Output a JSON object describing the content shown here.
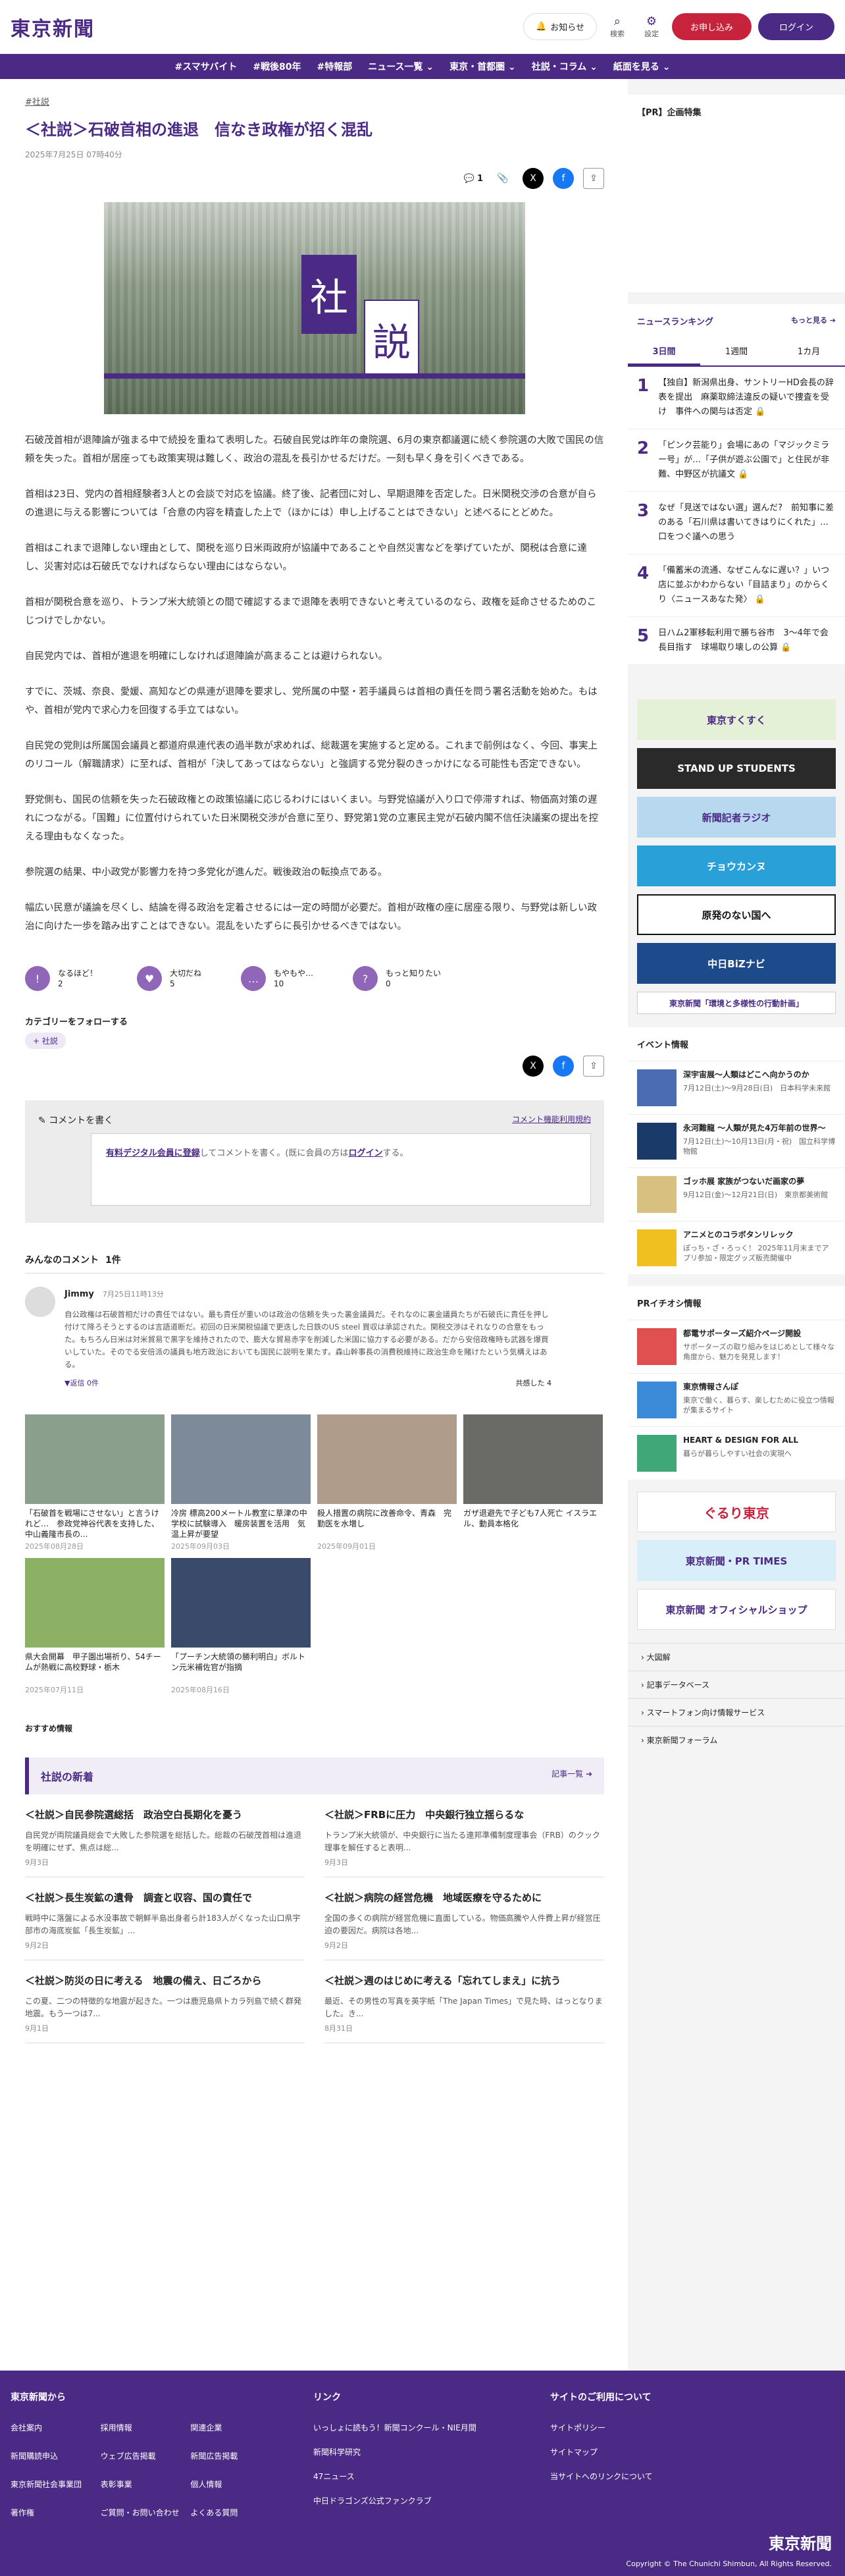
{
  "header": {
    "logo": "東京新聞",
    "notice": "お知らせ",
    "search": "検索",
    "settings": "設定",
    "apply": "お申し込み",
    "login": "ログイン"
  },
  "nav": [
    "#スマサバイト",
    "#戦後80年",
    "#特報部",
    "ニュース一覧 ⌄",
    "東京・首都圏 ⌄",
    "社説・コラム ⌄",
    "紙面を見る ⌄"
  ],
  "article": {
    "tag": "#社説",
    "title": "＜社説＞石破首相の進退　信なき政権が招く混乱",
    "date": "2025年7月25日 07時40分",
    "comment_count": "1",
    "hero_k1": "社",
    "hero_k2": "説",
    "paragraphs": [
      "石破茂首相が退陣論が強まる中で続投を重ねて表明した。石破自民党は昨年の衆院選、6月の東京都議選に続く参院選の大敗で国民の信頼を失った。首相が居座っても政策実現は難しく、政治の混乱を長引かせるだけだ。一刻も早く身を引くべきである。",
      "首相は23日、党内の首相経験者3人との会談で対応を協議。終了後、記者団に対し、早期退陣を否定した。日米関税交渉の合意が自らの進退に与える影響については「合意の内容を精査した上で（ほかには）申し上げることはできない」と述べるにとどめた。",
      "首相はこれまで退陣しない理由として、関税を巡り日米両政府が協議中であることや自然災害などを挙げていたが、関税は合意に達し、災害対応は石破氏でなければならない理由にはならない。",
      "首相が関税合意を巡り、トランプ米大統領との間で確認するまで退陣を表明できないと考えているのなら、政権を延命させるためのこじつけでしかない。",
      "自民党内では、首相が進退を明確にしなければ退陣論が高まることは避けられない。",
      "すでに、茨城、奈良、愛媛、高知などの県連が退陣を要求し、党所属の中堅・若手議員らは首相の責任を問う署名活動を始めた。もはや、首相が党内で求心力を回復する手立てはない。",
      "自民党の党則は所属国会議員と都道府県連代表の過半数が求めれば、総裁選を実施すると定める。これまで前例はなく、今回、事実上のリコール（解職請求）に至れば、首相が「決してあってはならない」と強調する党分裂のきっかけになる可能性も否定できない。",
      "野党側も、国民の信頼を失った石破政権との政策協議に応じるわけにはいくまい。与野党協議が入り口で停滞すれば、物価高対策の遅れにつながる。「国難」に位置付けられていた日米関税交渉が合意に至り、野党第1党の立憲民主党が石破内閣不信任決議案の提出を控える理由もなくなった。",
      "参院選の結果、中小政党が影響力を持つ多党化が進んだ。戦後政治の転換点である。",
      "幅広い民意が議論を尽くし、結論を得る政治を定着させるには一定の時間が必要だ。首相が政権の座に居座る限り、与野党は新しい政治に向けた一歩を踏み出すことはできない。混乱をいたずらに長引かせるべきではない。"
    ],
    "reactions": [
      {
        "label": "なるほど！",
        "count": "2",
        "icon": "!"
      },
      {
        "label": "大切だね",
        "count": "5",
        "icon": "♥"
      },
      {
        "label": "もやもや…",
        "count": "10",
        "icon": "…"
      },
      {
        "label": "もっと知りたい",
        "count": "0",
        "icon": "?"
      }
    ],
    "follow": "カテゴリーをフォローする",
    "chip": "+ 社説"
  },
  "comments": {
    "write": "コメントを書く",
    "rules": "コメント機能利用規約",
    "prompt_link": "有料デジタル会員に登録",
    "prompt_mid": "してコメントを書く。(既に会員の方は",
    "prompt_login": "ログイン",
    "prompt_end": "する。",
    "header": "みんなのコメント",
    "count": "1件",
    "items": [
      {
        "name": "Jimmy",
        "date": "7月25日11時13分",
        "text": "自公政権は石破首相だけの責任ではない。最も責任が重いのは政治の信頼を失った裏金議員だ。それなのに裏金議員たちが石破氏に責任を押し付けて降ろそうとするのは言語道断だ。初回の日米関税協議で更迭した日鉄のUS steel 買収は承認された。関税交渉はそれなりの合意をもった。もちろん日米は対米貿易で黒字を維持されたので、膨大な貿易赤字を削減した米国に協力する必要がある。だから安倍政権時も武器を爆買いしていた。そのでる安倍派の議員も地方政治においても国民に説明を果たす。森山幹事長の消費税維持に政治生命を賭けたという気構えはある。",
        "reply": "▼返信",
        "replies": "0件",
        "like": "共感した 4"
      }
    ]
  },
  "related": [
    {
      "cap": "「石破首を戦場にさせない」と言うけれど…　参政党神谷代表を支持した、中山義隆市長の...",
      "date": "2025年08月28日"
    },
    {
      "cap": "冷房 標高200メートル教室に草津の中学校に試験導入　暖房装置を活用　気温上昇が要望",
      "date": "2025年09月03日"
    },
    {
      "cap": "殺人措置の病院に改善命令、青森　完勤医を水増し",
      "date": "2025年09月01日"
    },
    {
      "cap": "ガザ退避先で子ども7人死亡 イスラエル、動員本格化",
      "date": ""
    },
    {
      "cap": "県大会開幕　甲子園出場祈り、54チームが熱戦に高校野球・栃木",
      "date": "2025年07月11日"
    },
    {
      "cap": "「プーチン大統領の勝利明白」ボルトン元米補佐官が指摘",
      "date": "2025年08月16日"
    }
  ],
  "recommend": "おすすめ情報",
  "latest": {
    "title": "社説の新着",
    "more": "記事一覧 ➔",
    "items": [
      {
        "t": "＜社説＞自民参院選総括　政治空白長期化を憂う",
        "s": "自民党が両院議員総会で大敗した参院選を総括した。総裁の石破茂首相は進退を明確にせず、焦点は総...",
        "d": "9月3日"
      },
      {
        "t": "＜社説＞FRBに圧力　中央銀行独立揺らるな",
        "s": "トランプ米大統領が、中央銀行に当たる連邦準備制度理事会（FRB）のクック理事を解任すると表明...",
        "d": "9月3日"
      },
      {
        "t": "＜社説＞長生炭鉱の遺骨　調査と収容、国の責任で",
        "s": "戦時中に落盤による水没事故で朝鮮半島出身者ら計183人がくなった山口県宇部市の海底炭鉱「長生炭鉱」...",
        "d": "9月2日"
      },
      {
        "t": "＜社説＞病院の経営危機　地域医療を守るために",
        "s": "全国の多くの病院が経営危機に直面している。物価高騰や人件費上昇が経営圧迫の要因だ。病院は各地...",
        "d": "9月2日"
      },
      {
        "t": "＜社説＞防災の日に考える　地震の備え、日ごろから",
        "s": "この夏、二つの特徴的な地震が起きた。一つは鹿児島県トカラ列島で続く群発地震。もう一つは7...",
        "d": "9月1日"
      },
      {
        "t": "＜社説＞週のはじめに考える「忘れてしまえ」に抗う",
        "s": "最近、その男性の写真を英字紙「The Japan Times」で見た時、はっとなりました。き...",
        "d": "8月31日"
      }
    ]
  },
  "sidebar": {
    "pr": "【PR】企画特集",
    "ranking": "ニュースランキング",
    "rank_more": "もっと見る ➔",
    "tabs": [
      "3日間",
      "1週間",
      "1カ月"
    ],
    "rank": [
      "【独自】新潟県出身、サントリーHD会長の辞表を提出　麻薬取締法違反の疑いで捜査を受け　事件への関与は否定 🔒",
      "「ピンク芸能り」会場にあの「マジックミラー号」が…「子供が遊ぶ公園で」と住民が非難、中野区が抗議文 🔒",
      "なぜ「見送ではない選」選んだ?　前知事に差のある「石川県は書いてきはりにくれた」…口をつぐ議への思う",
      "「備蓄米の流通、なぜこんなに遅い？」いつ店に並ぶかわからない「目詰まり」のからくり〈ニュースあなた発〉 🔒",
      "日ハム2軍移転利用で勝ち谷市　3〜4年で会長目指す　球場取り壊しの公算 🔒"
    ],
    "banners": [
      "東京すくすく",
      "STAND UP STUDENTS",
      "新聞記者ラジオ",
      "チョウカンヌ",
      "原発のない国へ",
      "中日BiZナビ",
      "東京新聞「環境と多様性の行動計画」"
    ],
    "events_title": "イベント情報",
    "events": [
      {
        "t": "深宇宙展～人類はどこへ向かうのか",
        "s": "7月12日(土)～9月28日(日)　日本科学未来館"
      },
      {
        "t": "永河難龍 ～人類が見た4万年前の世界～",
        "s": "7月12日(土)～10月13日(月・祝)　国立科学博物館"
      },
      {
        "t": "ゴッホ展 家族がつないだ画家の夢",
        "s": "9月12日(金)～12月21日(日)　東京都美術館"
      },
      {
        "t": "アニメとのコラボタンリレック",
        "s": "ぽっち・ざ・ろっく！ 2025年11月末までアプリ参加・限定グッズ販売開催中"
      }
    ],
    "pr2_title": "PRイチオシ情報",
    "pr2": [
      {
        "t": "都電サポーターズ紹介ページ開設",
        "s": "サポーターズの取り組みをはじめとして様々な角度から、魅力を発見します！"
      },
      {
        "t": "東京情報さんぽ",
        "s": "東京で働く、暮らす、楽しむために役立つ情報が集まるサイト"
      },
      {
        "t": "HEART & DESIGN FOR ALL",
        "s": "暮らが暮らしやすい社会の実現へ"
      }
    ],
    "banners2": [
      "ぐるり東京",
      "東京新聞・PR TIMES",
      "東京新聞 オフィシャルショップ"
    ],
    "links": [
      "大図解",
      "記事データベース",
      "スマートフォン向け情報サービス",
      "東京新聞フォーラム"
    ]
  },
  "footer": {
    "c1_title": "東京新聞から",
    "c1": [
      "会社案内",
      "採用情報",
      "関連企業",
      "新聞購読申込",
      "ウェブ広告掲載",
      "新聞広告掲載",
      "東京新聞社会事業団",
      "表彰事業",
      "個人情報",
      "著作権",
      "ご質問・お問い合わせ",
      "よくある質問"
    ],
    "c2_title": "リンク",
    "c2": [
      "いっしょに読もう！新聞コンクール・NIE月間",
      "新聞科学研究",
      "47ニュース",
      "中日ドラゴンズ公式ファンクラブ"
    ],
    "c3_title": "サイトのご利用について",
    "c3": [
      "サイトポリシー",
      "サイトマップ",
      "当サイトへのリンクについて"
    ],
    "logo": "東京新聞",
    "copy": "Copyright © The Chunichi Shimbun, All Rights Reserved."
  },
  "colors": {
    "brand": "#4a2a85",
    "accent": "#c8233c"
  }
}
